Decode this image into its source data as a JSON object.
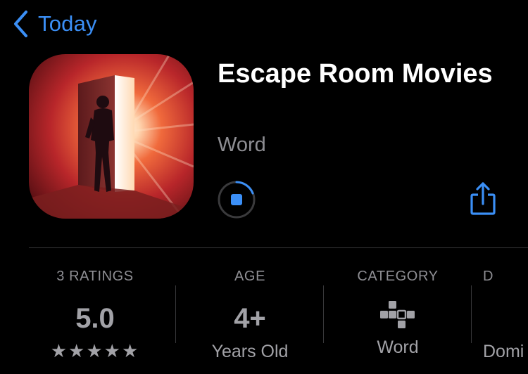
{
  "nav": {
    "back_label": "Today",
    "back_icon": "chevron-left-icon",
    "accent": "#3b8ff6"
  },
  "app": {
    "title": "Escape Room Movies",
    "subtitle": "Word",
    "icon": "app-icon-escape-room",
    "download_state": "downloading",
    "share_icon": "share-icon"
  },
  "info": {
    "ratings": {
      "header": "3 RATINGS",
      "value": "5.0",
      "stars": "★★★★★",
      "star_count": 5
    },
    "age": {
      "header": "AGE",
      "value": "4+",
      "sub": "Years Old"
    },
    "category": {
      "header": "CATEGORY",
      "icon": "crossword-icon",
      "sub": "Word"
    },
    "developer": {
      "header": "D",
      "sub": "Domi"
    }
  }
}
